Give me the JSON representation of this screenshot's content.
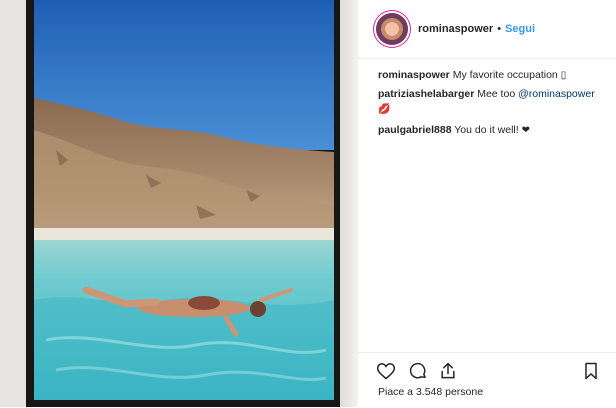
{
  "post": {
    "username": "rominaspower",
    "separator": "•",
    "follow_label": "Segui",
    "likes_text": "Piace a 3.548 persone"
  },
  "comments": [
    {
      "author": "rominaspower",
      "text": "My favorite occupation",
      "emoji": "▯"
    },
    {
      "author": "patriziashelabarger",
      "text": "Mee too",
      "mention": "@rominaspower",
      "emoji": "💋"
    },
    {
      "author": "paulgabriel888",
      "text": "You do it well!",
      "emoji": "❤"
    }
  ],
  "icons": [
    "heart-icon",
    "comment-icon",
    "share-icon",
    "bookmark-icon"
  ],
  "colors": {
    "link": "#3897f0",
    "mention": "#003569",
    "text": "#262626",
    "sky": "#2f6fbf",
    "water": "#5fc4cc"
  }
}
